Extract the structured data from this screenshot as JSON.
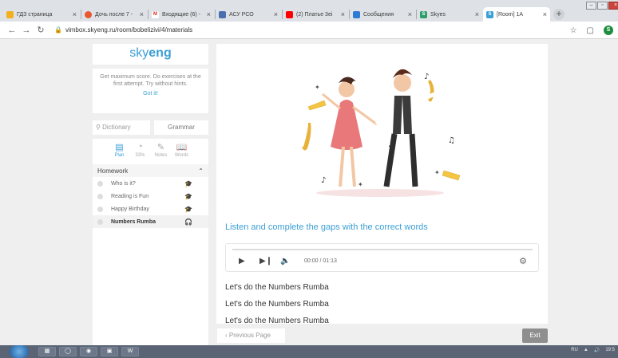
{
  "browser": {
    "tabs": [
      {
        "title": "ГДЗ страница",
        "icon_color": "#f2b01e"
      },
      {
        "title": "Дочь после 7 -",
        "icon_color": "#e8572e"
      },
      {
        "title": "Входящие (6) -",
        "icon_color": "#d93025",
        "glyph": "M"
      },
      {
        "title": "АСУ РСО",
        "icon_color": "#4b6fae"
      },
      {
        "title": "(2) Платье 3ei",
        "icon_color": "#ff0000"
      },
      {
        "title": "Сообщения",
        "icon_color": "#2d7bd4"
      },
      {
        "title": "Skyes",
        "icon_color": "#2b9e6a",
        "glyph": "S"
      },
      {
        "title": "[Room] 1A",
        "icon_color": "#3b9fd6",
        "glyph": "S"
      }
    ],
    "close_glyph": "×",
    "new_tab": "+",
    "url": "vimbox.skyeng.ru/room/bobelizivi/4/materials",
    "back": "←",
    "forward": "→",
    "reload": "↻",
    "star": "☆",
    "profile_letter": "S",
    "window_min": "–",
    "window_max": "▫",
    "window_close": "×"
  },
  "sidebar": {
    "logo_light": "sky",
    "logo_bold": "eng",
    "tip_text": "Get maximum score. Do exercises at the first attempt. Try without hints.",
    "tip_link": "Got it!",
    "dictionary_placeholder": "Dictionary",
    "grammar_label": "Grammar",
    "modes": [
      {
        "label": "Plan",
        "icon": "plan-icon",
        "active": true
      },
      {
        "label": "33%",
        "icon": "progress-icon",
        "active": false
      },
      {
        "label": "Notes",
        "icon": "notes-icon",
        "active": false
      },
      {
        "label": "Words",
        "icon": "words-icon",
        "active": false
      }
    ],
    "homework_title": "Homework",
    "homework_items": [
      {
        "label": "Who is it?",
        "icon": "graduation-cap-icon"
      },
      {
        "label": "Reading is Fun",
        "icon": "graduation-cap-icon"
      },
      {
        "label": "Happy Birthday",
        "icon": "graduation-cap-icon"
      },
      {
        "label": "Numbers Rumba",
        "icon": "headphones-icon",
        "active": true
      }
    ]
  },
  "main": {
    "task_title": "Listen and complete the gaps with the correct words",
    "player": {
      "time": "00:00 / 01:13",
      "progress": 0
    },
    "lyrics": [
      "Let's do the Numbers Rumba",
      "Let's do the Numbers Rumba",
      "Let's do the Numbers Rumba"
    ]
  },
  "footer": {
    "prev_label": "Previous Page",
    "exit_label": "Exit"
  },
  "taskbar": {
    "lang": "RU",
    "clock": "19:5"
  },
  "colors": {
    "accent": "#3b9fd6",
    "exit_bg": "#8e8e8e"
  }
}
